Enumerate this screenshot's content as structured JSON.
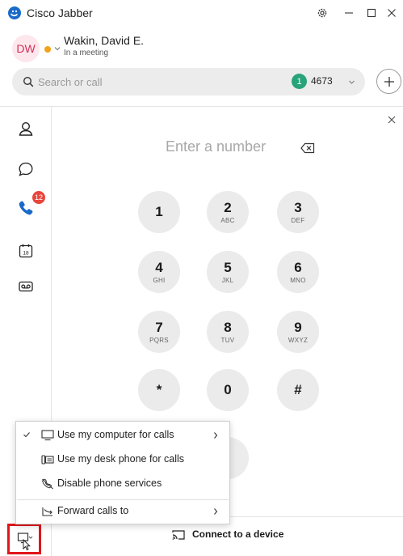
{
  "window": {
    "title": "Cisco Jabber"
  },
  "profile": {
    "initials": "DW",
    "name": "Wakin, David E.",
    "status": "In a meeting"
  },
  "search": {
    "placeholder": "Search or call",
    "line_count": "1",
    "line_number": "4673"
  },
  "rail": {
    "calls_badge": "12",
    "calendar_day": "18"
  },
  "dialpad": {
    "placeholder": "Enter a number",
    "keys": [
      {
        "digit": "1",
        "letters": ""
      },
      {
        "digit": "2",
        "letters": "ABC"
      },
      {
        "digit": "3",
        "letters": "DEF"
      },
      {
        "digit": "4",
        "letters": "GHI"
      },
      {
        "digit": "5",
        "letters": "JKL"
      },
      {
        "digit": "6",
        "letters": "MNO"
      },
      {
        "digit": "7",
        "letters": "PQRS"
      },
      {
        "digit": "8",
        "letters": "TUV"
      },
      {
        "digit": "9",
        "letters": "WXYZ"
      },
      {
        "digit": "*",
        "letters": ""
      },
      {
        "digit": "0",
        "letters": ""
      },
      {
        "digit": "#",
        "letters": ""
      }
    ]
  },
  "connect": {
    "label": "Connect to a device"
  },
  "menu": {
    "items": [
      {
        "label": "Use my computer for calls",
        "icon": "computer-icon",
        "checked": true,
        "submenu": true
      },
      {
        "label": "Use my desk phone for calls",
        "icon": "desk-phone-icon",
        "checked": false,
        "submenu": false
      },
      {
        "label": "Disable phone services",
        "icon": "phone-disabled-icon",
        "checked": false,
        "submenu": false
      },
      {
        "label": "Forward calls to",
        "icon": "forward-icon",
        "checked": false,
        "submenu": true
      }
    ]
  },
  "colors": {
    "avatar_bg": "#fde7ec",
    "avatar_text": "#d2305a",
    "presence": "#f2a21a",
    "badge_green": "#28a37a",
    "badge_red": "#e8453c",
    "accent_blue": "#1b6ac9",
    "highlight_red": "#e0161b"
  }
}
